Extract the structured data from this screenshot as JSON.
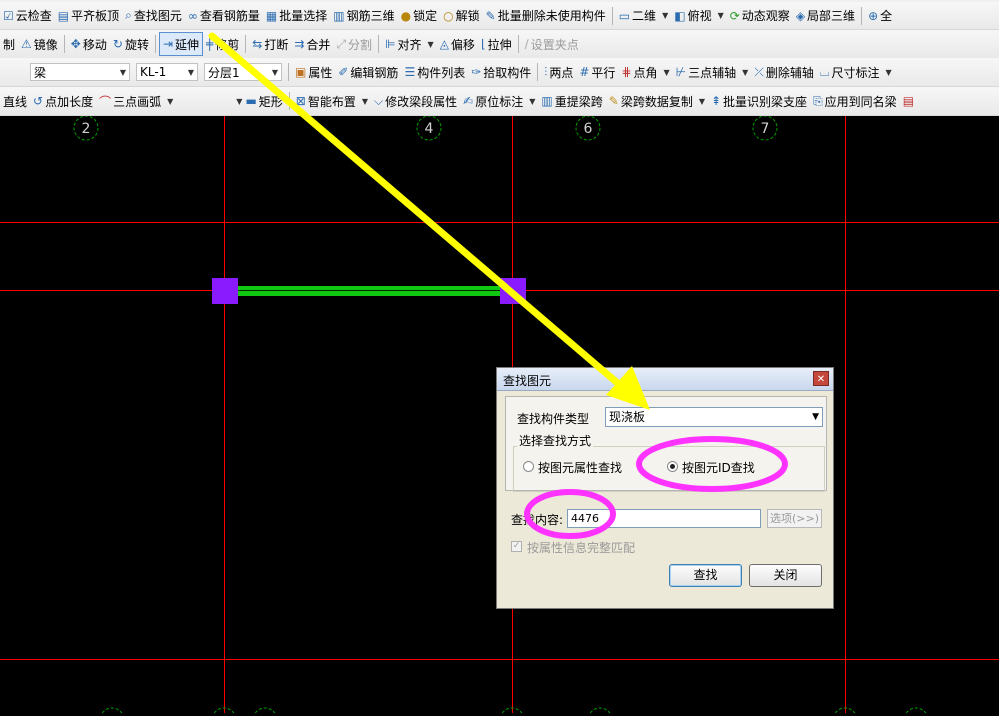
{
  "toolbar1": [
    "云检查",
    "平齐板顶",
    "查找图元",
    "查看钢筋量",
    "批量选择",
    "钢筋三维",
    "锁定",
    "解锁",
    "批量删除未使用构件",
    "二维",
    "俯视",
    "动态观察",
    "局部三维",
    "全"
  ],
  "toolbar2": [
    "制",
    "镜像",
    "移动",
    "旋转",
    "延伸",
    "修剪",
    "打断",
    "合并",
    "分割",
    "对齐",
    "偏移",
    "拉伸",
    "设置夹点"
  ],
  "toolbar3": {
    "combos": [
      "梁",
      "KL-1",
      "分层1"
    ],
    "items": [
      "属性",
      "编辑钢筋",
      "构件列表",
      "拾取构件",
      "两点",
      "平行",
      "点角",
      "三点辅轴",
      "删除辅轴",
      "尺寸标注"
    ]
  },
  "toolbar4": [
    "直线",
    "点加长度",
    "三点画弧",
    "矩形",
    "智能布置",
    "修改梁段属性",
    "原位标注",
    "重提梁跨",
    "梁跨数据复制",
    "批量识别梁支座",
    "应用到同名梁"
  ],
  "axes": [
    "2",
    "4",
    "6",
    "7"
  ],
  "colors": {
    "grid": "#ff0000",
    "beam": "#12c912",
    "column": "#8a1bff",
    "arrow": "#ffff00",
    "highlight": "#ff33ff",
    "axis_label": "#00a000"
  },
  "dialog": {
    "title": "查找图元",
    "type_label": "查找构件类型",
    "type_value": "现浇板",
    "mode_title": "选择查找方式",
    "radio_attr": "按图元属性查找",
    "radio_id": "按图元ID查找",
    "content_label": "查找内容:",
    "content_value": "4476",
    "options_button": "选项(>>)",
    "match_checkbox": "按属性信息完整匹配",
    "find_button": "查找",
    "close_button": "关闭"
  }
}
